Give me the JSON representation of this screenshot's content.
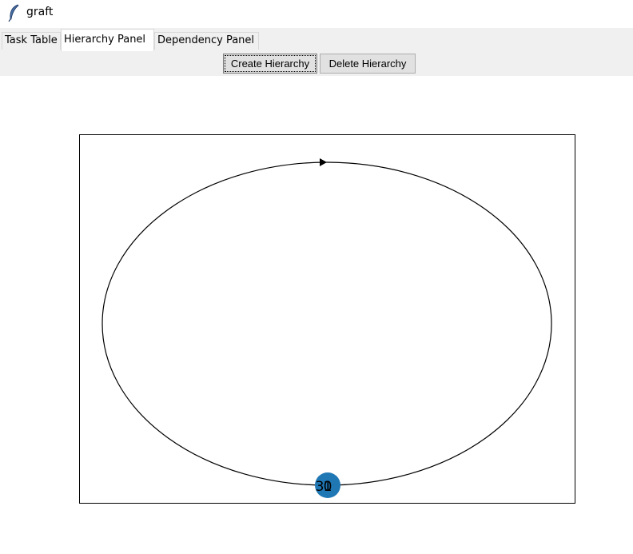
{
  "window": {
    "title": "graft",
    "icon": "feather-icon"
  },
  "tabs": [
    {
      "label": "Task Table",
      "active": false
    },
    {
      "label": "Hierarchy Panel",
      "active": true
    },
    {
      "label": "Dependency Panel",
      "active": false
    }
  ],
  "toolbar": {
    "create_label": "Create Hierarchy",
    "delete_label": "Delete Hierarchy"
  },
  "graph": {
    "nodes": [
      {
        "label": "3"
      },
      {
        "label": "1"
      },
      {
        "label": "0"
      }
    ],
    "node_color": "#1f77b4",
    "edge_color": "#000000",
    "frame_color": "#000000"
  }
}
